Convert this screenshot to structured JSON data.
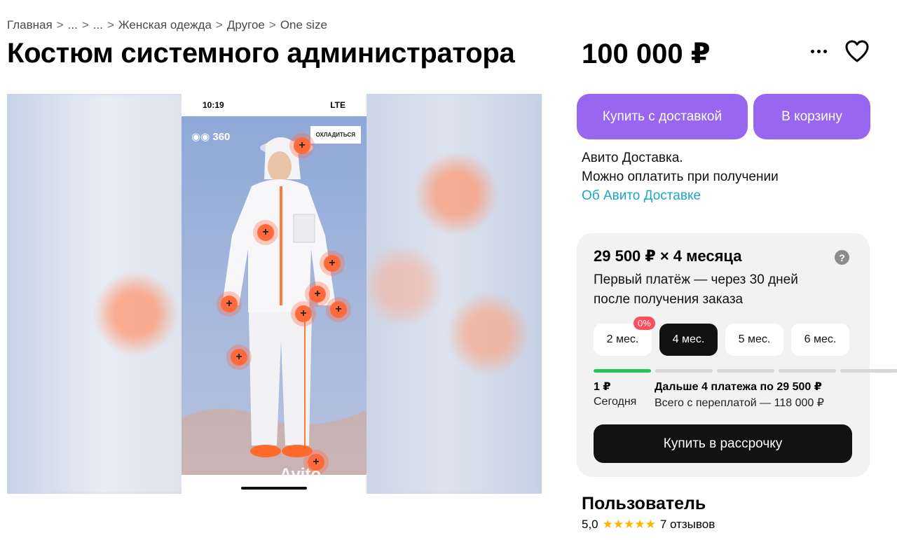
{
  "breadcrumb": [
    "Главная",
    "...",
    "...",
    "Женская одежда",
    "Другое",
    "One size"
  ],
  "breadcrumb_sep": ">",
  "title": "Костюм системного администратора",
  "price": "100 000 ₽",
  "icons": {
    "more": "more-dots-icon",
    "favorite": "heart-icon",
    "help": "question-icon"
  },
  "gallery": {
    "status_time": "10:19",
    "status_network": "LTE",
    "logo": "360",
    "cool_button": "ОХЛАДИТЬСЯ",
    "watermark": "Avito"
  },
  "buttons": {
    "buy_delivery": "Купить с доставкой",
    "cart": "В корзину"
  },
  "delivery": {
    "line1": "Авито Доставка.",
    "line2": "Можно оплатить при получении",
    "link": "Об Авито Доставке"
  },
  "installment": {
    "title": "29 500 ₽ × 4 месяца",
    "help": "?",
    "description": "Первый платёж — через 30 дней после получения заказа",
    "badge": "0%",
    "months": [
      "2 мес.",
      "4 мес.",
      "5 мес.",
      "6 мес."
    ],
    "active_month": "4 мес.",
    "today_amount": "1 ₽",
    "today_label": "Сегодня",
    "rest_amount": "Дальше 4 платежа по 29 500 ₽",
    "rest_total": "Всего с переплатой — 118 000 ₽",
    "button": "Купить в рассрочку"
  },
  "seller": {
    "name": "Пользователь",
    "rating": "5,0",
    "stars": 5,
    "reviews": "7 отзывов"
  },
  "colors": {
    "accent": "#9966f0",
    "link": "#1aa6c8",
    "badge": "#ff4d5e",
    "progress": "#20c45a",
    "star": "#ffb400"
  }
}
